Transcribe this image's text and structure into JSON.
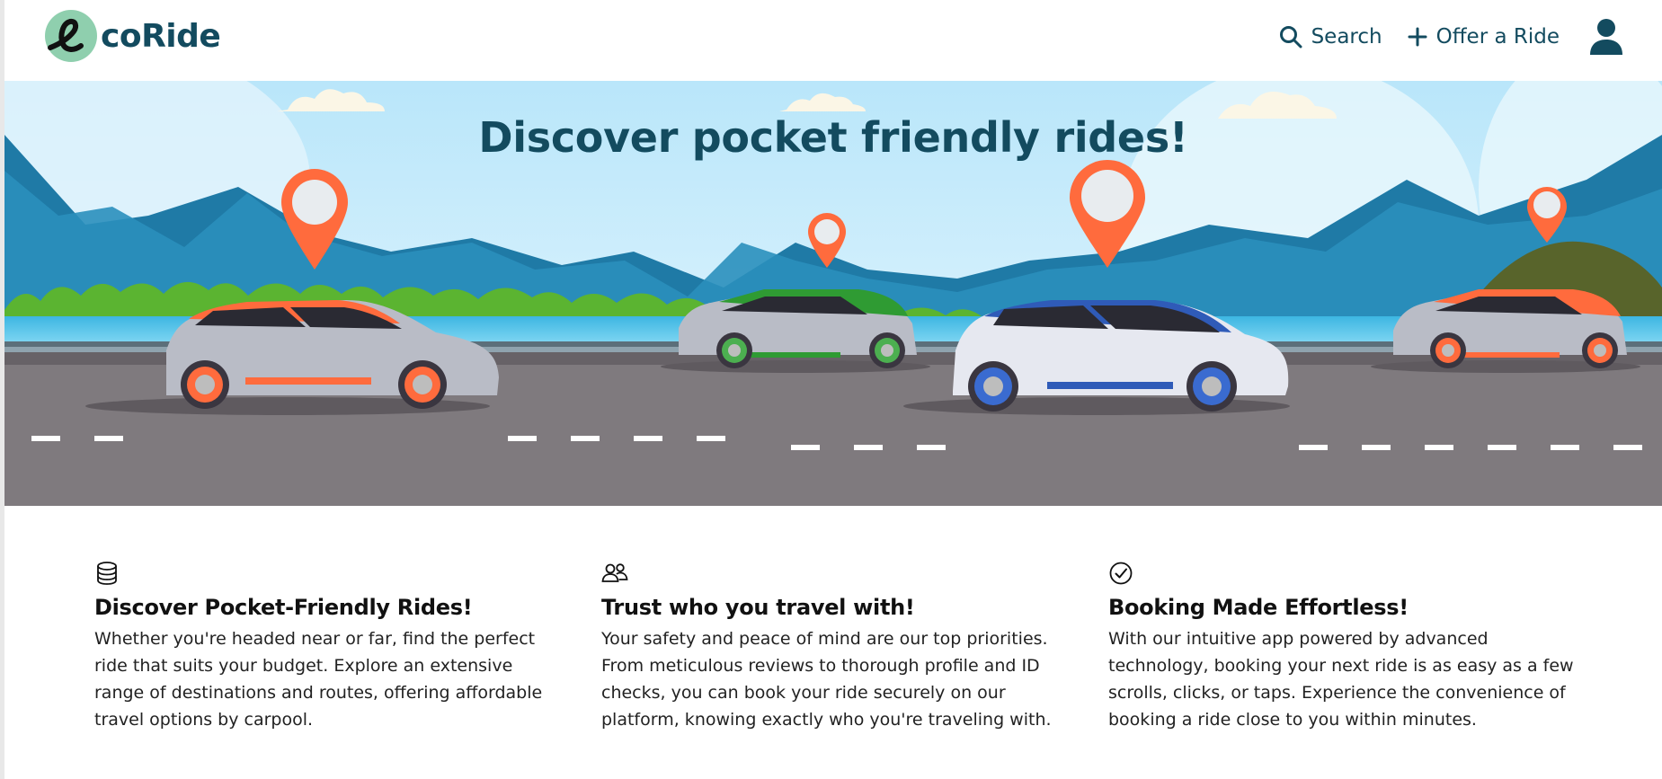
{
  "brand": {
    "name": "coRide",
    "logo_letter": "e"
  },
  "nav": {
    "search_label": "Search",
    "offer_label": "Offer a Ride"
  },
  "hero": {
    "title": "Discover pocket friendly rides!"
  },
  "features": [
    {
      "icon": "database-stack-icon",
      "title": "Discover Pocket-Friendly Rides!",
      "text": "Whether you're headed near or far, find the perfect ride that suits your budget. Explore an extensive range of destinations and routes, offering affordable travel options by carpool."
    },
    {
      "icon": "people-icon",
      "title": "Trust who you travel with!",
      "text": "Your safety and peace of mind are our top priorities. From meticulous reviews to thorough profile and ID checks, you can book your ride securely on our platform, knowing exactly who you're traveling with."
    },
    {
      "icon": "check-circle-icon",
      "title": "Booking Made Effortless!",
      "text": "With our intuitive app powered by advanced technology, booking your next ride is as easy as a few scrolls, clicks, or taps. Experience the convenience of booking a ride close to you within minutes."
    }
  ],
  "colors": {
    "brand": "#134b5f",
    "logo_circle": "#8fcfae",
    "pin": "#ff6b3d",
    "sky": "#cfeefc",
    "road": "#7f7a7e",
    "water": "#4fc3e8"
  }
}
